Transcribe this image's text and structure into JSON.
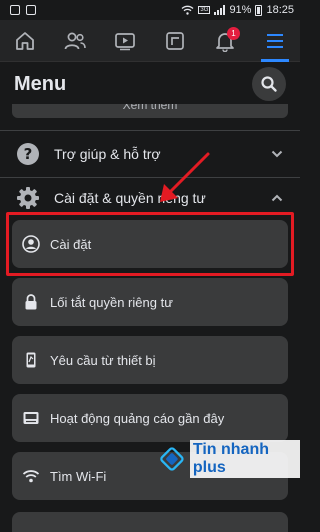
{
  "statusbar": {
    "signal_badge": "3G",
    "battery_percent": "91%",
    "time": "18:25"
  },
  "navbar": {
    "notification_count": "1",
    "active_tab": "menu"
  },
  "menu": {
    "title": "Menu",
    "see_more_label": "Xem thêm"
  },
  "sections": {
    "help_label": "Trợ giúp & hỗ trợ",
    "settings_privacy_label": "Cài đặt & quyền riêng tư"
  },
  "cards": [
    {
      "label": "Cài đặt",
      "icon": "account-circle-icon"
    },
    {
      "label": "Lối tắt quyền riêng tư",
      "icon": "lock-icon"
    },
    {
      "label": "Yêu cầu từ thiết bị",
      "icon": "device-icon"
    },
    {
      "label": "Hoạt động quảng cáo gần đây",
      "icon": "ad-activity-icon"
    },
    {
      "label": "Tìm Wi-Fi",
      "icon": "wifi-icon"
    }
  ],
  "watermark": {
    "text": "Tin nhanh plus"
  },
  "colors": {
    "background": "#18191a",
    "card": "#3a3b3c",
    "accent": "#2d88ff",
    "highlight": "#e31b23"
  }
}
